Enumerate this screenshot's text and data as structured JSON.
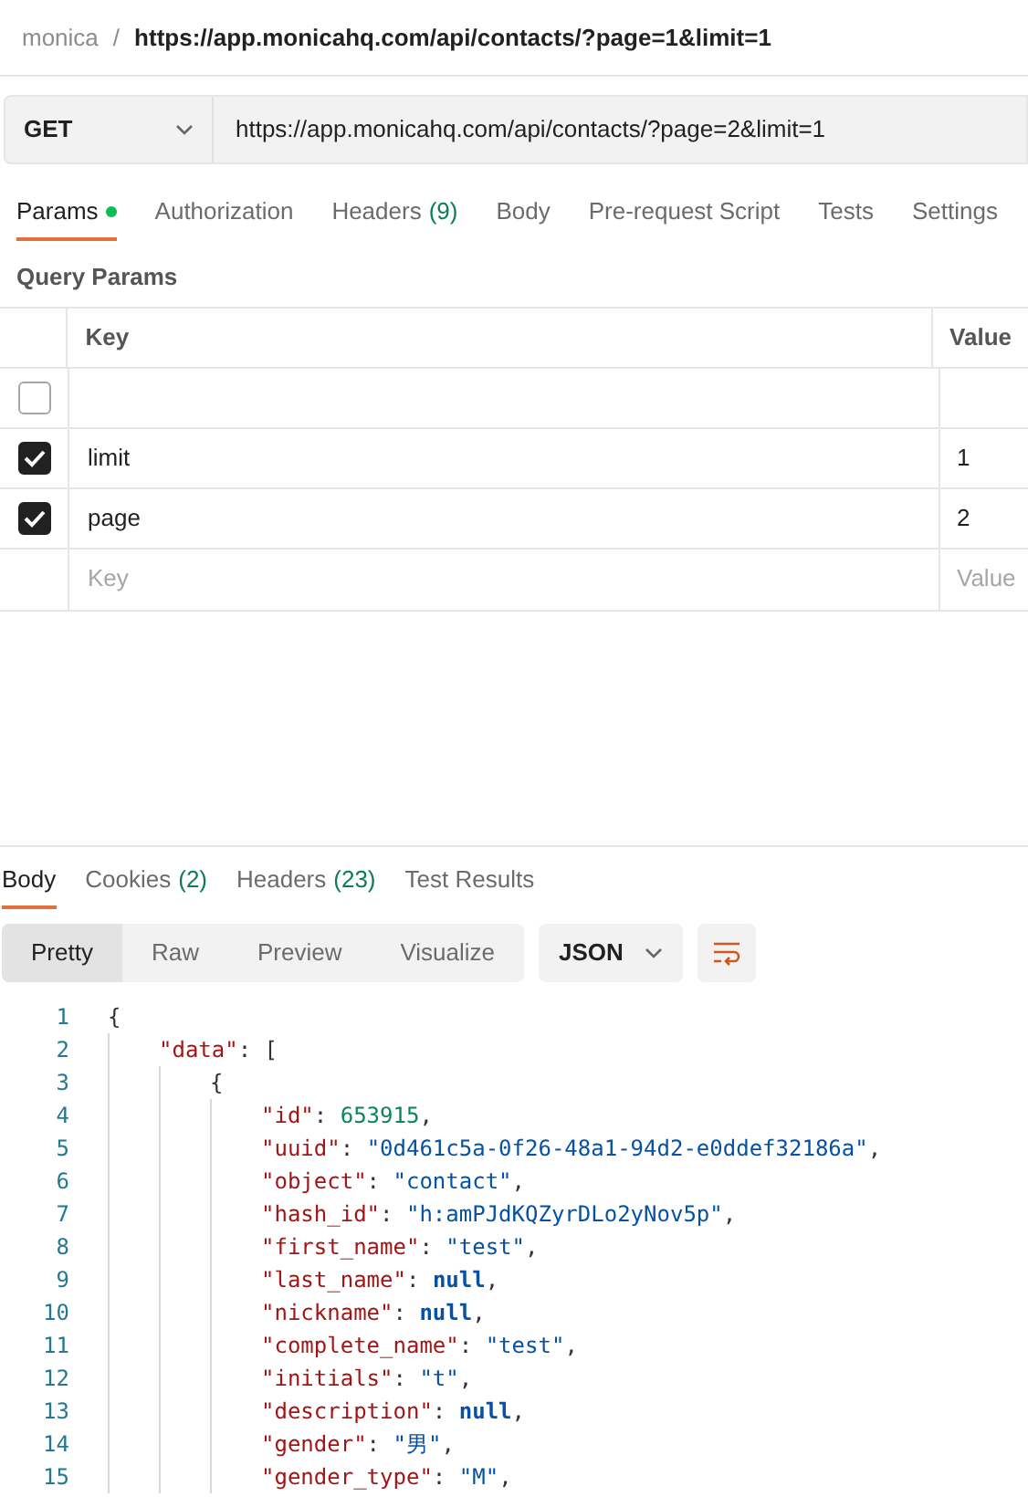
{
  "breadcrumb": {
    "collection": "monica",
    "separator": "/",
    "request": "https://app.monicahq.com/api/contacts/?page=1&limit=1"
  },
  "request": {
    "method": "GET",
    "url": "https://app.monicahq.com/api/contacts/?page=2&limit=1"
  },
  "request_tabs": [
    {
      "label": "Params",
      "dot": true,
      "selected": true
    },
    {
      "label": "Authorization",
      "dot": false,
      "selected": false
    },
    {
      "label": "Headers",
      "count": "(9)",
      "dot": false,
      "selected": false
    },
    {
      "label": "Body",
      "dot": false,
      "selected": false
    },
    {
      "label": "Pre-request Script",
      "dot": false,
      "selected": false
    },
    {
      "label": "Tests",
      "dot": false,
      "selected": false
    },
    {
      "label": "Settings",
      "dot": false,
      "selected": false
    }
  ],
  "query_params": {
    "title": "Query Params",
    "columns": [
      "Key",
      "Value"
    ],
    "rows": [
      {
        "kind": "param",
        "checked": false,
        "key": "",
        "value": ""
      },
      {
        "kind": "param",
        "checked": true,
        "key": "limit",
        "value": "1"
      },
      {
        "kind": "param",
        "checked": true,
        "key": "page",
        "value": "2"
      },
      {
        "kind": "new",
        "key_placeholder": "Key",
        "value_placeholder": "Value"
      }
    ]
  },
  "response_tabs": [
    {
      "label": "Body",
      "selected": true
    },
    {
      "label": "Cookies",
      "count": "(2)",
      "selected": false
    },
    {
      "label": "Headers",
      "count": "(23)",
      "selected": false
    },
    {
      "label": "Test Results",
      "selected": false
    }
  ],
  "view_modes": [
    {
      "label": "Pretty",
      "selected": true
    },
    {
      "label": "Raw",
      "selected": false
    },
    {
      "label": "Preview",
      "selected": false
    },
    {
      "label": "Visualize",
      "selected": false
    }
  ],
  "format": "JSON",
  "code": [
    {
      "number": "1",
      "tokens": [
        {
          "kind": "punct",
          "text": "{"
        }
      ],
      "children": [
        {
          "number": "2",
          "tokens": [
            {
              "kind": "key",
              "text": "\"data\""
            },
            {
              "kind": "punct",
              "text": ": ["
            }
          ],
          "children": [
            {
              "number": "3",
              "tokens": [
                {
                  "kind": "punct",
                  "text": "{"
                }
              ],
              "children": [
                {
                  "number": "4",
                  "tokens": [
                    {
                      "kind": "key",
                      "text": "\"id\""
                    },
                    {
                      "kind": "punct",
                      "text": ": "
                    },
                    {
                      "kind": "number",
                      "text": "653915"
                    },
                    {
                      "kind": "punct",
                      "text": ","
                    }
                  ]
                },
                {
                  "number": "5",
                  "tokens": [
                    {
                      "kind": "key",
                      "text": "\"uuid\""
                    },
                    {
                      "kind": "punct",
                      "text": ": "
                    },
                    {
                      "kind": "string",
                      "text": "\"0d461c5a-0f26-48a1-94d2-e0ddef32186a\""
                    },
                    {
                      "kind": "punct",
                      "text": ","
                    }
                  ]
                },
                {
                  "number": "6",
                  "tokens": [
                    {
                      "kind": "key",
                      "text": "\"object\""
                    },
                    {
                      "kind": "punct",
                      "text": ": "
                    },
                    {
                      "kind": "string",
                      "text": "\"contact\""
                    },
                    {
                      "kind": "punct",
                      "text": ","
                    }
                  ]
                },
                {
                  "number": "7",
                  "tokens": [
                    {
                      "kind": "key",
                      "text": "\"hash_id\""
                    },
                    {
                      "kind": "punct",
                      "text": ": "
                    },
                    {
                      "kind": "string",
                      "text": "\"h:amPJdKQZyrDLo2yNov5p\""
                    },
                    {
                      "kind": "punct",
                      "text": ","
                    }
                  ]
                },
                {
                  "number": "8",
                  "tokens": [
                    {
                      "kind": "key",
                      "text": "\"first_name\""
                    },
                    {
                      "kind": "punct",
                      "text": ": "
                    },
                    {
                      "kind": "string",
                      "text": "\"test\""
                    },
                    {
                      "kind": "punct",
                      "text": ","
                    }
                  ]
                },
                {
                  "number": "9",
                  "tokens": [
                    {
                      "kind": "key",
                      "text": "\"last_name\""
                    },
                    {
                      "kind": "punct",
                      "text": ": "
                    },
                    {
                      "kind": "null",
                      "text": "null"
                    },
                    {
                      "kind": "punct",
                      "text": ","
                    }
                  ]
                },
                {
                  "number": "10",
                  "tokens": [
                    {
                      "kind": "key",
                      "text": "\"nickname\""
                    },
                    {
                      "kind": "punct",
                      "text": ": "
                    },
                    {
                      "kind": "null",
                      "text": "null"
                    },
                    {
                      "kind": "punct",
                      "text": ","
                    }
                  ]
                },
                {
                  "number": "11",
                  "tokens": [
                    {
                      "kind": "key",
                      "text": "\"complete_name\""
                    },
                    {
                      "kind": "punct",
                      "text": ": "
                    },
                    {
                      "kind": "string",
                      "text": "\"test\""
                    },
                    {
                      "kind": "punct",
                      "text": ","
                    }
                  ]
                },
                {
                  "number": "12",
                  "tokens": [
                    {
                      "kind": "key",
                      "text": "\"initials\""
                    },
                    {
                      "kind": "punct",
                      "text": ": "
                    },
                    {
                      "kind": "string",
                      "text": "\"t\""
                    },
                    {
                      "kind": "punct",
                      "text": ","
                    }
                  ]
                },
                {
                  "number": "13",
                  "tokens": [
                    {
                      "kind": "key",
                      "text": "\"description\""
                    },
                    {
                      "kind": "punct",
                      "text": ": "
                    },
                    {
                      "kind": "null",
                      "text": "null"
                    },
                    {
                      "kind": "punct",
                      "text": ","
                    }
                  ]
                },
                {
                  "number": "14",
                  "tokens": [
                    {
                      "kind": "key",
                      "text": "\"gender\""
                    },
                    {
                      "kind": "punct",
                      "text": ": "
                    },
                    {
                      "kind": "string",
                      "text": "\"男\""
                    },
                    {
                      "kind": "punct",
                      "text": ","
                    }
                  ]
                },
                {
                  "number": "15",
                  "tokens": [
                    {
                      "kind": "key",
                      "text": "\"gender_type\""
                    },
                    {
                      "kind": "punct",
                      "text": ": "
                    },
                    {
                      "kind": "string",
                      "text": "\"M\""
                    },
                    {
                      "kind": "punct",
                      "text": ","
                    }
                  ]
                }
              ]
            }
          ]
        }
      ]
    }
  ]
}
